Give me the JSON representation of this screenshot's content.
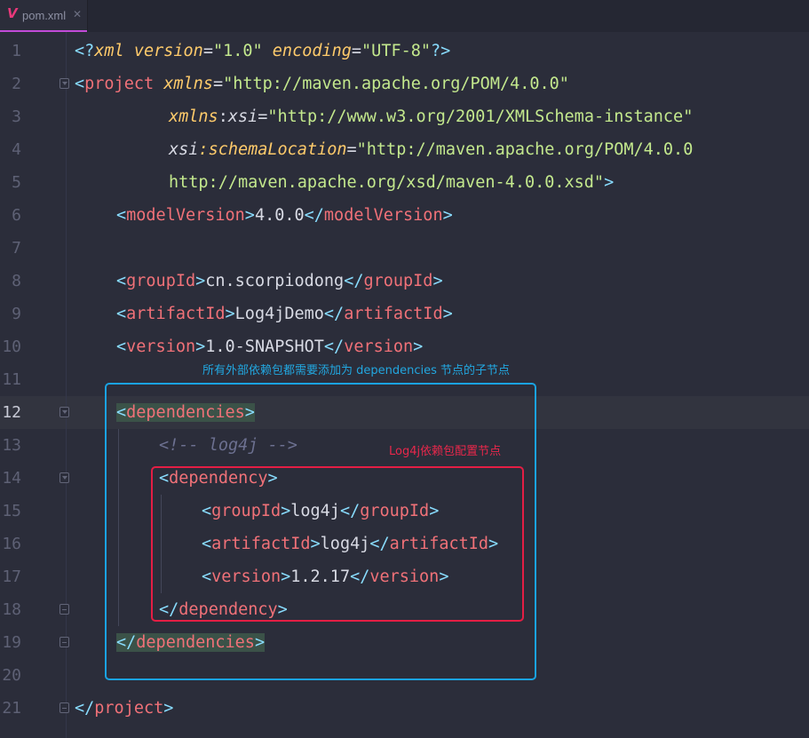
{
  "tab": {
    "title": "pom.xml",
    "logo": "V",
    "close": "✕"
  },
  "code": {
    "l1": {
      "pi_open": "<?",
      "kw": "xml",
      "attr1": "version",
      "eq1": "=",
      "val1": "\"1.0\"",
      "attr2": "encoding",
      "eq2": "=",
      "val2": "\"UTF-8\"",
      "pi_close": "?>"
    },
    "l2": {
      "lt": "<",
      "tag": "project",
      "attr": "xmlns",
      "eq": "=",
      "val": "\"http://maven.apache.org/POM/4.0.0\""
    },
    "l3": {
      "ns": "xmlns",
      "colon": ":",
      "local": "xsi",
      "eq": "=",
      "val": "\"http://www.w3.org/2001/XMLSchema-instance\""
    },
    "l4": {
      "ns": "xsi",
      "colon": ":",
      "local": "schemaLocation",
      "eq": "=",
      "val": "\"http://maven.apache.org/POM/4.0.0"
    },
    "l5": {
      "val": "http://maven.apache.org/xsd/maven-4.0.0.xsd\"",
      "gt": ">"
    },
    "l6": {
      "open": "modelVersion",
      "text": "4.0.0"
    },
    "l8": {
      "open": "groupId",
      "text": "cn.scorpiodong"
    },
    "l9": {
      "open": "artifactId",
      "text": "Log4jDemo"
    },
    "l10": {
      "open": "version",
      "text": "1.0-SNAPSHOT"
    },
    "l12": {
      "open": "dependencies"
    },
    "l13": {
      "comment": "<!-- log4j -->"
    },
    "l14": {
      "open": "dependency"
    },
    "l15": {
      "open": "groupId",
      "text": "log4j"
    },
    "l16": {
      "open": "artifactId",
      "text": "log4j"
    },
    "l17": {
      "open": "version",
      "text": "1.2.17"
    },
    "l18": {
      "close": "dependency"
    },
    "l19": {
      "close": "dependencies"
    },
    "l21": {
      "close": "project"
    },
    "sym": {
      "lt": "<",
      "gt": ">",
      "lts": "</"
    }
  },
  "line_numbers": [
    "1",
    "2",
    "3",
    "4",
    "5",
    "6",
    "7",
    "8",
    "9",
    "10",
    "11",
    "12",
    "13",
    "14",
    "15",
    "16",
    "17",
    "18",
    "19",
    "20",
    "21"
  ],
  "annotations": {
    "blue_note": "所有外部依赖包都需要添加为 dependencies 节点的子节点",
    "red_note": "Log4j依赖包配置节点"
  },
  "colors": {
    "blue_box": "#1aa3e2",
    "red_box": "#e41e44",
    "tag": "#f07178",
    "string": "#c3e88d",
    "attribute": "#ffcb6b",
    "bracket": "#89ddff"
  }
}
